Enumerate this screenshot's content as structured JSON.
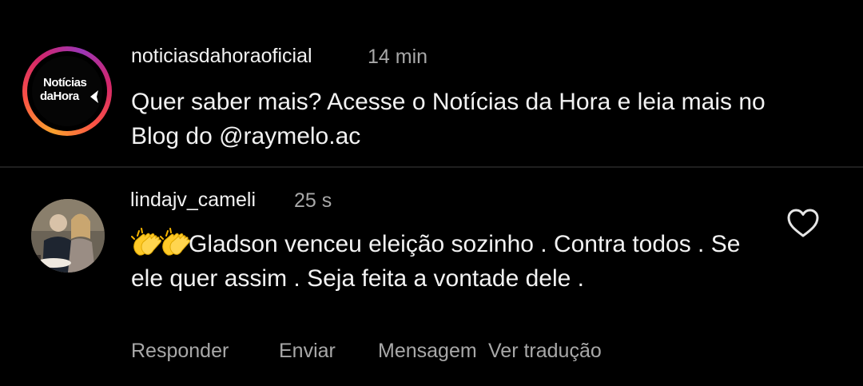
{
  "post": {
    "username": "noticiasdahoraoficial",
    "time": "14 min",
    "text": "Quer saber mais? Acesse o Notícias da Hora e leia mais no Blog do @raymelo.ac",
    "avatar": {
      "logo_line1": "Notícias",
      "logo_line2": "daHora"
    }
  },
  "comment": {
    "username": "lindajv_cameli",
    "time": "25 s",
    "text": "Gladson venceu eleição sozinho . Contra todos . Se ele quer assim . Seja feita a vontade dele .",
    "emoji": "clapping-hands-icon"
  },
  "actions": {
    "reply": "Responder",
    "send": "Enviar",
    "message": "Mensagem",
    "translate": "Ver tradução"
  },
  "colors": {
    "background": "#000000",
    "text": "#f2f2f2",
    "muted": "#a8a8a8",
    "divider": "#1f1f1f"
  }
}
